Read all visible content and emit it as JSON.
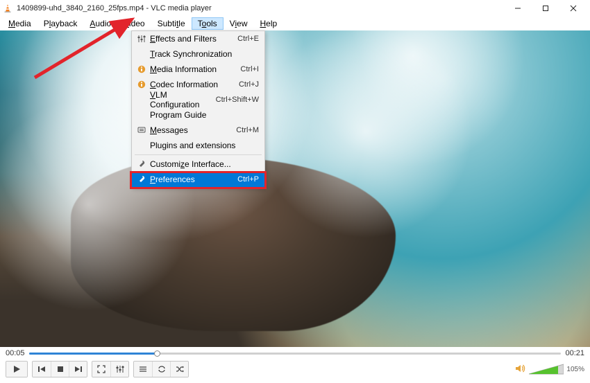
{
  "title": "1409899-uhd_3840_2160_25fps.mp4 - VLC media player",
  "menubar": {
    "media": "Media",
    "playback": "Playback",
    "audio": "Audio",
    "video": "Video",
    "subtitle": "Subtitle",
    "tools": "Tools",
    "view": "View",
    "help": "Help"
  },
  "dropdown": {
    "effects": {
      "label": "Effects and Filters",
      "shortcut": "Ctrl+E"
    },
    "track_sync": {
      "label": "Track Synchronization",
      "shortcut": ""
    },
    "media_info": {
      "label": "Media Information",
      "shortcut": "Ctrl+I"
    },
    "codec_info": {
      "label": "Codec Information",
      "shortcut": "Ctrl+J"
    },
    "vlm": {
      "label": "VLM Configuration",
      "shortcut": "Ctrl+Shift+W"
    },
    "program_guide": {
      "label": "Program Guide",
      "shortcut": ""
    },
    "messages": {
      "label": "Messages",
      "shortcut": "Ctrl+M"
    },
    "plugins": {
      "label": "Plugins and extensions",
      "shortcut": ""
    },
    "customize": {
      "label": "Customize Interface...",
      "shortcut": ""
    },
    "preferences": {
      "label": "Preferences",
      "shortcut": "Ctrl+P"
    }
  },
  "time": {
    "current": "00:05",
    "total": "00:21",
    "progress_pct": 24
  },
  "volume": {
    "pct_label": "105%",
    "pct": 105
  }
}
